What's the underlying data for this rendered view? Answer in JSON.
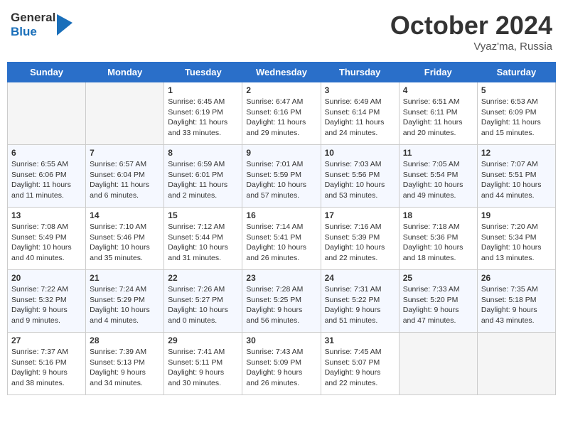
{
  "header": {
    "logo_general": "General",
    "logo_blue": "Blue",
    "month": "October 2024",
    "location": "Vyaz'ma, Russia"
  },
  "days_of_week": [
    "Sunday",
    "Monday",
    "Tuesday",
    "Wednesday",
    "Thursday",
    "Friday",
    "Saturday"
  ],
  "weeks": [
    [
      {
        "day": "",
        "empty": true
      },
      {
        "day": "",
        "empty": true
      },
      {
        "day": "1",
        "sunrise": "6:45 AM",
        "sunset": "6:19 PM",
        "daylight": "11 hours and 33 minutes."
      },
      {
        "day": "2",
        "sunrise": "6:47 AM",
        "sunset": "6:16 PM",
        "daylight": "11 hours and 29 minutes."
      },
      {
        "day": "3",
        "sunrise": "6:49 AM",
        "sunset": "6:14 PM",
        "daylight": "11 hours and 24 minutes."
      },
      {
        "day": "4",
        "sunrise": "6:51 AM",
        "sunset": "6:11 PM",
        "daylight": "11 hours and 20 minutes."
      },
      {
        "day": "5",
        "sunrise": "6:53 AM",
        "sunset": "6:09 PM",
        "daylight": "11 hours and 15 minutes."
      }
    ],
    [
      {
        "day": "6",
        "sunrise": "6:55 AM",
        "sunset": "6:06 PM",
        "daylight": "11 hours and 11 minutes."
      },
      {
        "day": "7",
        "sunrise": "6:57 AM",
        "sunset": "6:04 PM",
        "daylight": "11 hours and 6 minutes."
      },
      {
        "day": "8",
        "sunrise": "6:59 AM",
        "sunset": "6:01 PM",
        "daylight": "11 hours and 2 minutes."
      },
      {
        "day": "9",
        "sunrise": "7:01 AM",
        "sunset": "5:59 PM",
        "daylight": "10 hours and 57 minutes."
      },
      {
        "day": "10",
        "sunrise": "7:03 AM",
        "sunset": "5:56 PM",
        "daylight": "10 hours and 53 minutes."
      },
      {
        "day": "11",
        "sunrise": "7:05 AM",
        "sunset": "5:54 PM",
        "daylight": "10 hours and 49 minutes."
      },
      {
        "day": "12",
        "sunrise": "7:07 AM",
        "sunset": "5:51 PM",
        "daylight": "10 hours and 44 minutes."
      }
    ],
    [
      {
        "day": "13",
        "sunrise": "7:08 AM",
        "sunset": "5:49 PM",
        "daylight": "10 hours and 40 minutes."
      },
      {
        "day": "14",
        "sunrise": "7:10 AM",
        "sunset": "5:46 PM",
        "daylight": "10 hours and 35 minutes."
      },
      {
        "day": "15",
        "sunrise": "7:12 AM",
        "sunset": "5:44 PM",
        "daylight": "10 hours and 31 minutes."
      },
      {
        "day": "16",
        "sunrise": "7:14 AM",
        "sunset": "5:41 PM",
        "daylight": "10 hours and 26 minutes."
      },
      {
        "day": "17",
        "sunrise": "7:16 AM",
        "sunset": "5:39 PM",
        "daylight": "10 hours and 22 minutes."
      },
      {
        "day": "18",
        "sunrise": "7:18 AM",
        "sunset": "5:36 PM",
        "daylight": "10 hours and 18 minutes."
      },
      {
        "day": "19",
        "sunrise": "7:20 AM",
        "sunset": "5:34 PM",
        "daylight": "10 hours and 13 minutes."
      }
    ],
    [
      {
        "day": "20",
        "sunrise": "7:22 AM",
        "sunset": "5:32 PM",
        "daylight": "9 hours and 9 minutes."
      },
      {
        "day": "21",
        "sunrise": "7:24 AM",
        "sunset": "5:29 PM",
        "daylight": "10 hours and 4 minutes."
      },
      {
        "day": "22",
        "sunrise": "7:26 AM",
        "sunset": "5:27 PM",
        "daylight": "10 hours and 0 minutes."
      },
      {
        "day": "23",
        "sunrise": "7:28 AM",
        "sunset": "5:25 PM",
        "daylight": "9 hours and 56 minutes."
      },
      {
        "day": "24",
        "sunrise": "7:31 AM",
        "sunset": "5:22 PM",
        "daylight": "9 hours and 51 minutes."
      },
      {
        "day": "25",
        "sunrise": "7:33 AM",
        "sunset": "5:20 PM",
        "daylight": "9 hours and 47 minutes."
      },
      {
        "day": "26",
        "sunrise": "7:35 AM",
        "sunset": "5:18 PM",
        "daylight": "9 hours and 43 minutes."
      }
    ],
    [
      {
        "day": "27",
        "sunrise": "7:37 AM",
        "sunset": "5:16 PM",
        "daylight": "9 hours and 38 minutes."
      },
      {
        "day": "28",
        "sunrise": "7:39 AM",
        "sunset": "5:13 PM",
        "daylight": "9 hours and 34 minutes."
      },
      {
        "day": "29",
        "sunrise": "7:41 AM",
        "sunset": "5:11 PM",
        "daylight": "9 hours and 30 minutes."
      },
      {
        "day": "30",
        "sunrise": "7:43 AM",
        "sunset": "5:09 PM",
        "daylight": "9 hours and 26 minutes."
      },
      {
        "day": "31",
        "sunrise": "7:45 AM",
        "sunset": "5:07 PM",
        "daylight": "9 hours and 22 minutes."
      },
      {
        "day": "",
        "empty": true
      },
      {
        "day": "",
        "empty": true
      }
    ]
  ]
}
